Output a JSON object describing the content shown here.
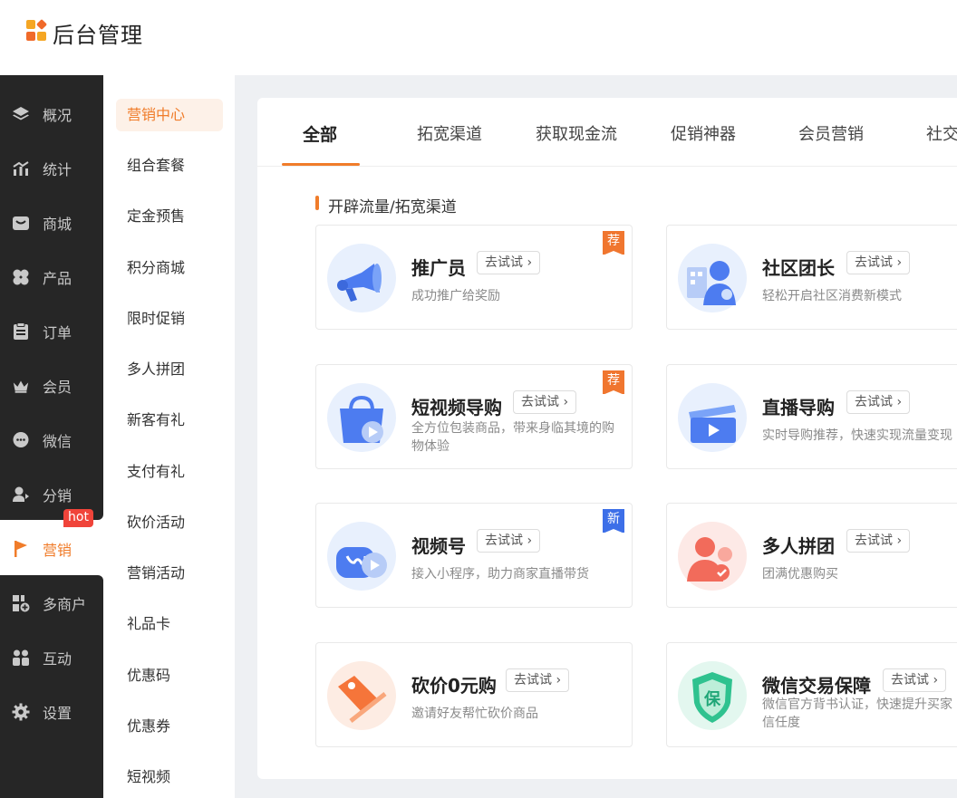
{
  "header": {
    "title": "后台管理",
    "logo_colors": [
      "#f5a623",
      "#f06a2a",
      "#f5a623",
      "#f06a2a"
    ]
  },
  "sidebar": {
    "items": [
      {
        "label": "概况",
        "icon": "layers-icon"
      },
      {
        "label": "统计",
        "icon": "stats-icon"
      },
      {
        "label": "商城",
        "icon": "mail-bag-icon"
      },
      {
        "label": "产品",
        "icon": "clover-icon"
      },
      {
        "label": "订单",
        "icon": "clipboard-icon"
      },
      {
        "label": "会员",
        "icon": "crown-icon"
      },
      {
        "label": "微信",
        "icon": "chat-bubble-icon"
      },
      {
        "label": "分销",
        "icon": "user-share-icon"
      },
      {
        "label": "营销",
        "icon": "flag-icon",
        "active": true,
        "badge": "hot"
      },
      {
        "label": "多商户",
        "icon": "store-plus-icon"
      },
      {
        "label": "互动",
        "icon": "group-icon"
      },
      {
        "label": "设置",
        "icon": "gear-icon"
      }
    ]
  },
  "submenu": {
    "items": [
      "营销中心",
      "组合套餐",
      "定金预售",
      "积分商城",
      "限时促销",
      "多人拼团",
      "新客有礼",
      "支付有礼",
      "砍价活动",
      "营销活动",
      "礼品卡",
      "优惠码",
      "优惠券",
      "短视频"
    ],
    "active_index": 0
  },
  "tabs": [
    "全部",
    "拓宽渠道",
    "获取现金流",
    "促销神器",
    "会员营销",
    "社交"
  ],
  "section": {
    "title": "开辟流量/拓宽渠道"
  },
  "try_label": "去试试",
  "accent_color": "#f07c2a",
  "cards": [
    {
      "title": "推广员",
      "desc": "成功推广给奖励",
      "badge": "荐",
      "icon": "megaphone-icon"
    },
    {
      "title": "社区团长",
      "desc": "轻松开启社区消费新模式",
      "badge": "",
      "icon": "community-leader-icon"
    },
    {
      "title": "短视频导购",
      "desc": "全方位包装商品，带来身临其境的购物体验",
      "badge": "荐",
      "icon": "shopping-bag-play-icon"
    },
    {
      "title": "直播导购",
      "desc": "实时导购推荐，快速实现流量变现",
      "badge": "",
      "icon": "clapperboard-icon"
    },
    {
      "title": "视频号",
      "desc": "接入小程序，助力商家直播带货",
      "badge": "新",
      "icon": "channels-icon"
    },
    {
      "title": "多人拼团",
      "desc": "团满优惠购买",
      "badge": "",
      "icon": "group-buy-icon"
    },
    {
      "title": "砍价0元购",
      "desc": "邀请好友帮忙砍价商品",
      "badge": "",
      "icon": "price-tag-icon"
    },
    {
      "title": "微信交易保障",
      "desc": "微信官方背书认证，快速提升买家信任度",
      "badge": "",
      "icon": "shield-guarantee-icon",
      "desc_lines": [
        "微信官方背书认证，快速提升买家",
        "信任度"
      ]
    }
  ]
}
